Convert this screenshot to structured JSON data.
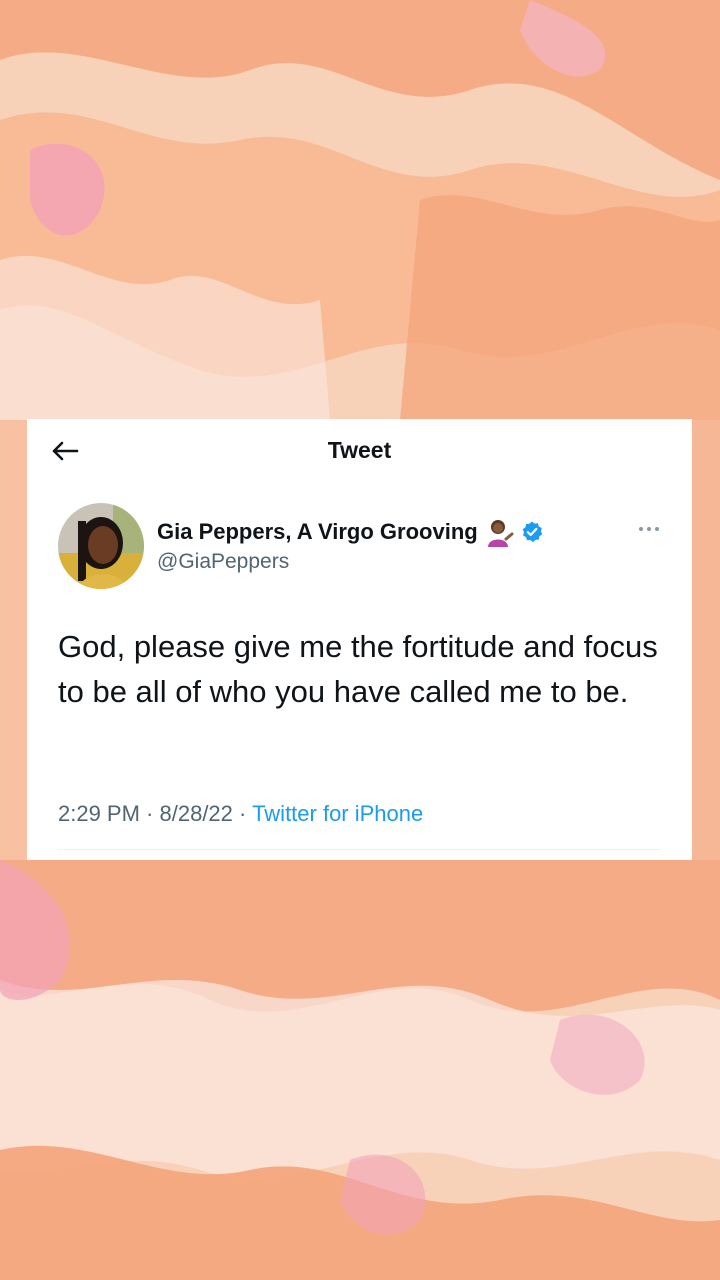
{
  "header": {
    "title": "Tweet",
    "back_icon": "arrow-left-icon"
  },
  "author": {
    "name": "Gia Peppers, A Virgo Grooving",
    "emoji_icon": "woman-tipping-hand-icon",
    "verified_icon": "verified-badge-icon",
    "handle": "@GiaPeppers"
  },
  "tweet": {
    "text": "God, please give me the fortitude and focus to be all of who you have called me to be.",
    "time": "2:29 PM",
    "date": "8/28/22",
    "separator": " · ",
    "source": "Twitter for iPhone"
  },
  "more_icon": "more-options-icon",
  "colors": {
    "text": "#0f1419",
    "secondary": "#536471",
    "accent": "#1d9bf0",
    "background": "#f6c7a6"
  }
}
